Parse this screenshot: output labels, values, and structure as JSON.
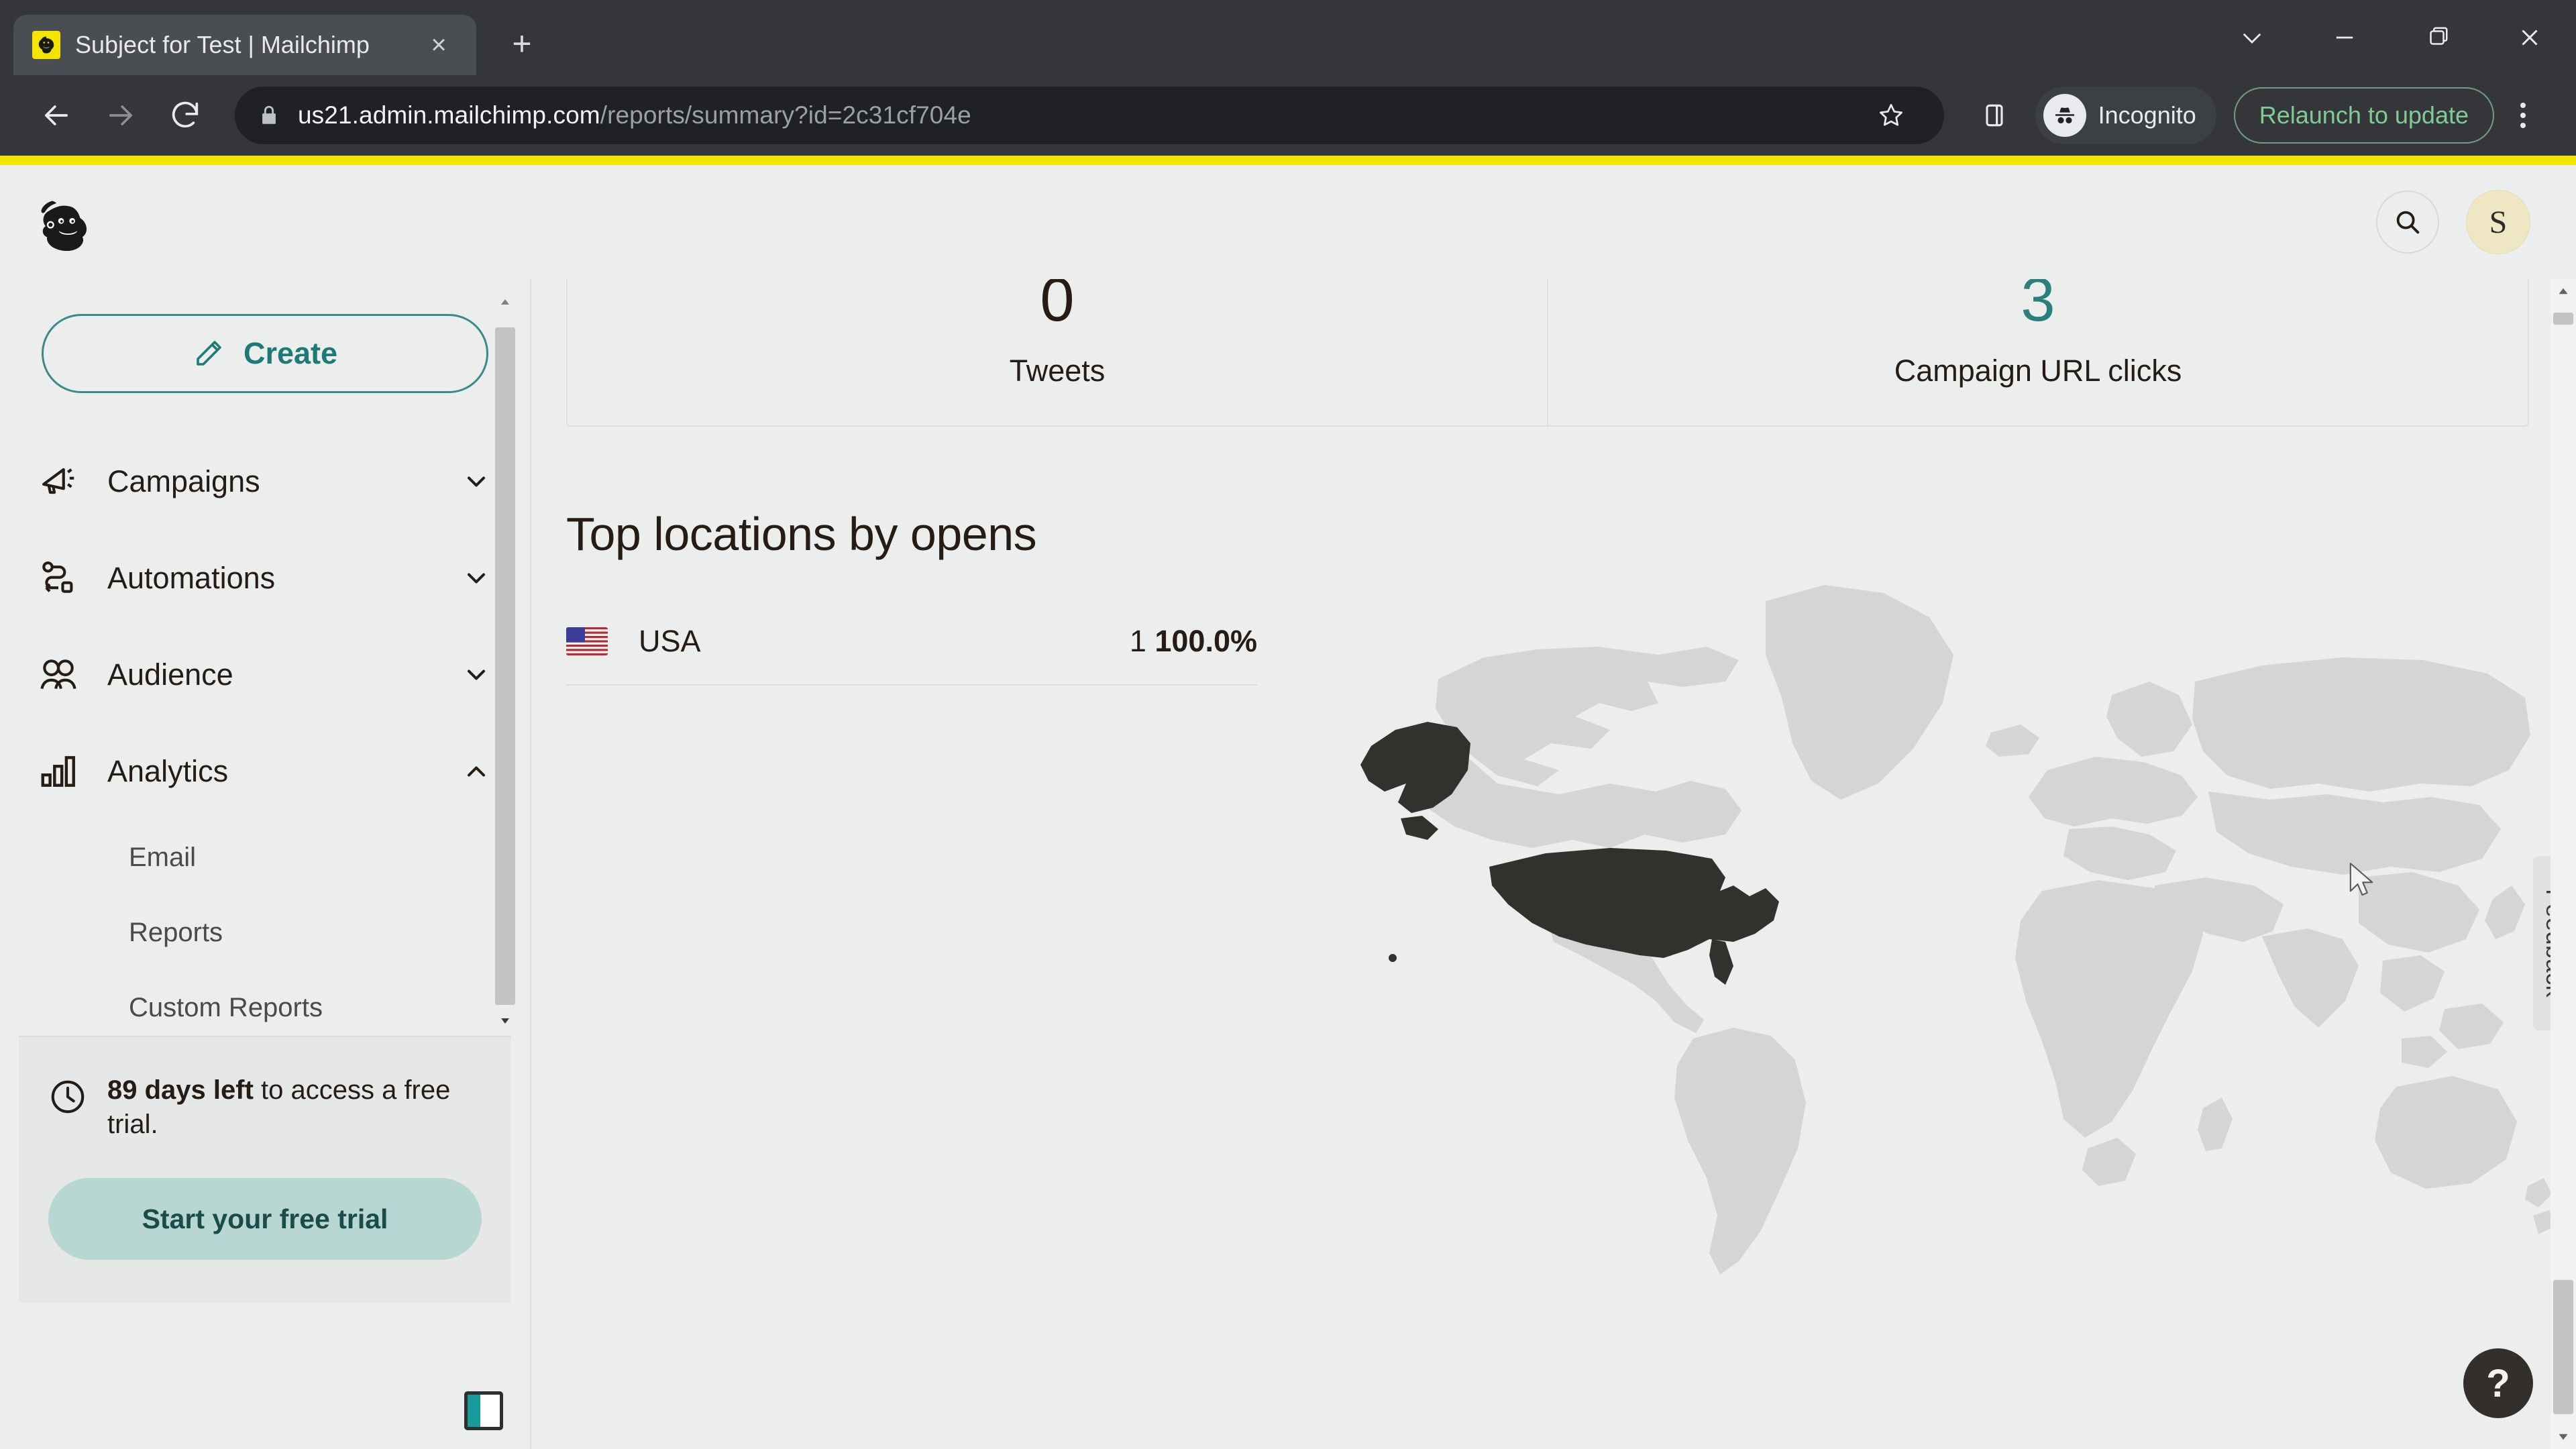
{
  "browser": {
    "tab": {
      "title": "Subject for Test | Mailchimp",
      "favicon": "mailchimp-favicon",
      "close_label": "×"
    },
    "new_tab_label": "+",
    "window_controls": {
      "minimize": "minimize-icon",
      "maximize": "maximize-icon",
      "restore": "restore-icon",
      "close": "close-icon"
    },
    "nav": {
      "back": "back-arrow-icon",
      "forward": "forward-arrow-icon",
      "reload": "reload-icon"
    },
    "omnibox": {
      "lock": "lock-icon",
      "url_host": "us21.admin.mailchimp.com",
      "url_path": "/reports/summary?id=2c31cf704e",
      "url_full": "us21.admin.mailchimp.com/reports/summary?id=2c31cf704e",
      "bookmark": "star-icon",
      "side_panel": "side-panel-icon"
    },
    "incognito": {
      "label": "Incognito",
      "icon": "incognito-hat-icon"
    },
    "relaunch": {
      "label": "Relaunch to update"
    },
    "menu": "three-dot-menu-icon"
  },
  "app": {
    "logo": "mailchimp-freddie-logo",
    "search": "search-icon",
    "avatar": {
      "initial": "S",
      "bg": "#efe7c3"
    }
  },
  "sidebar": {
    "create": {
      "label": "Create",
      "icon": "pencil-icon"
    },
    "nav": [
      {
        "label": "Campaigns",
        "icon": "megaphone-icon",
        "chevron": "chevron-down-icon",
        "expanded": false
      },
      {
        "label": "Automations",
        "icon": "automation-flow-icon",
        "chevron": "chevron-down-icon",
        "expanded": false
      },
      {
        "label": "Audience",
        "icon": "audience-people-icon",
        "chevron": "chevron-down-icon",
        "expanded": false
      },
      {
        "label": "Analytics",
        "icon": "bar-chart-icon",
        "chevron": "chevron-up-icon",
        "expanded": true
      }
    ],
    "analytics_subitems": [
      {
        "label": "Email"
      },
      {
        "label": "Reports"
      },
      {
        "label": "Custom Reports"
      }
    ],
    "trial": {
      "icon": "clock-icon",
      "days_bold": "89 days left",
      "rest": " to access a free trial.",
      "button": "Start your free trial"
    },
    "collapse_toggle": "sidebar-collapse-icon"
  },
  "main": {
    "stats": [
      {
        "value": "0",
        "label": "Tweets",
        "color": "#241c15"
      },
      {
        "value": "3",
        "label": "Campaign URL clicks",
        "color": "#2b7f7c"
      }
    ],
    "section_title": "Top locations by opens",
    "locations": [
      {
        "flag": "usa-flag-icon",
        "name": "USA",
        "count": "1",
        "percent": "100.0%"
      }
    ],
    "map": {
      "name": "world-map",
      "highlighted": [
        "USA"
      ],
      "highlight_color": "#33312e",
      "base_color": "#d3d4d4"
    },
    "feedback_tab": "Feedback",
    "help_button": "?"
  },
  "colors": {
    "accent_teal": "#2b7f7c",
    "brand_yellow": "#f2e500",
    "page_bg": "#eceded",
    "chrome_bg": "#35363a"
  }
}
